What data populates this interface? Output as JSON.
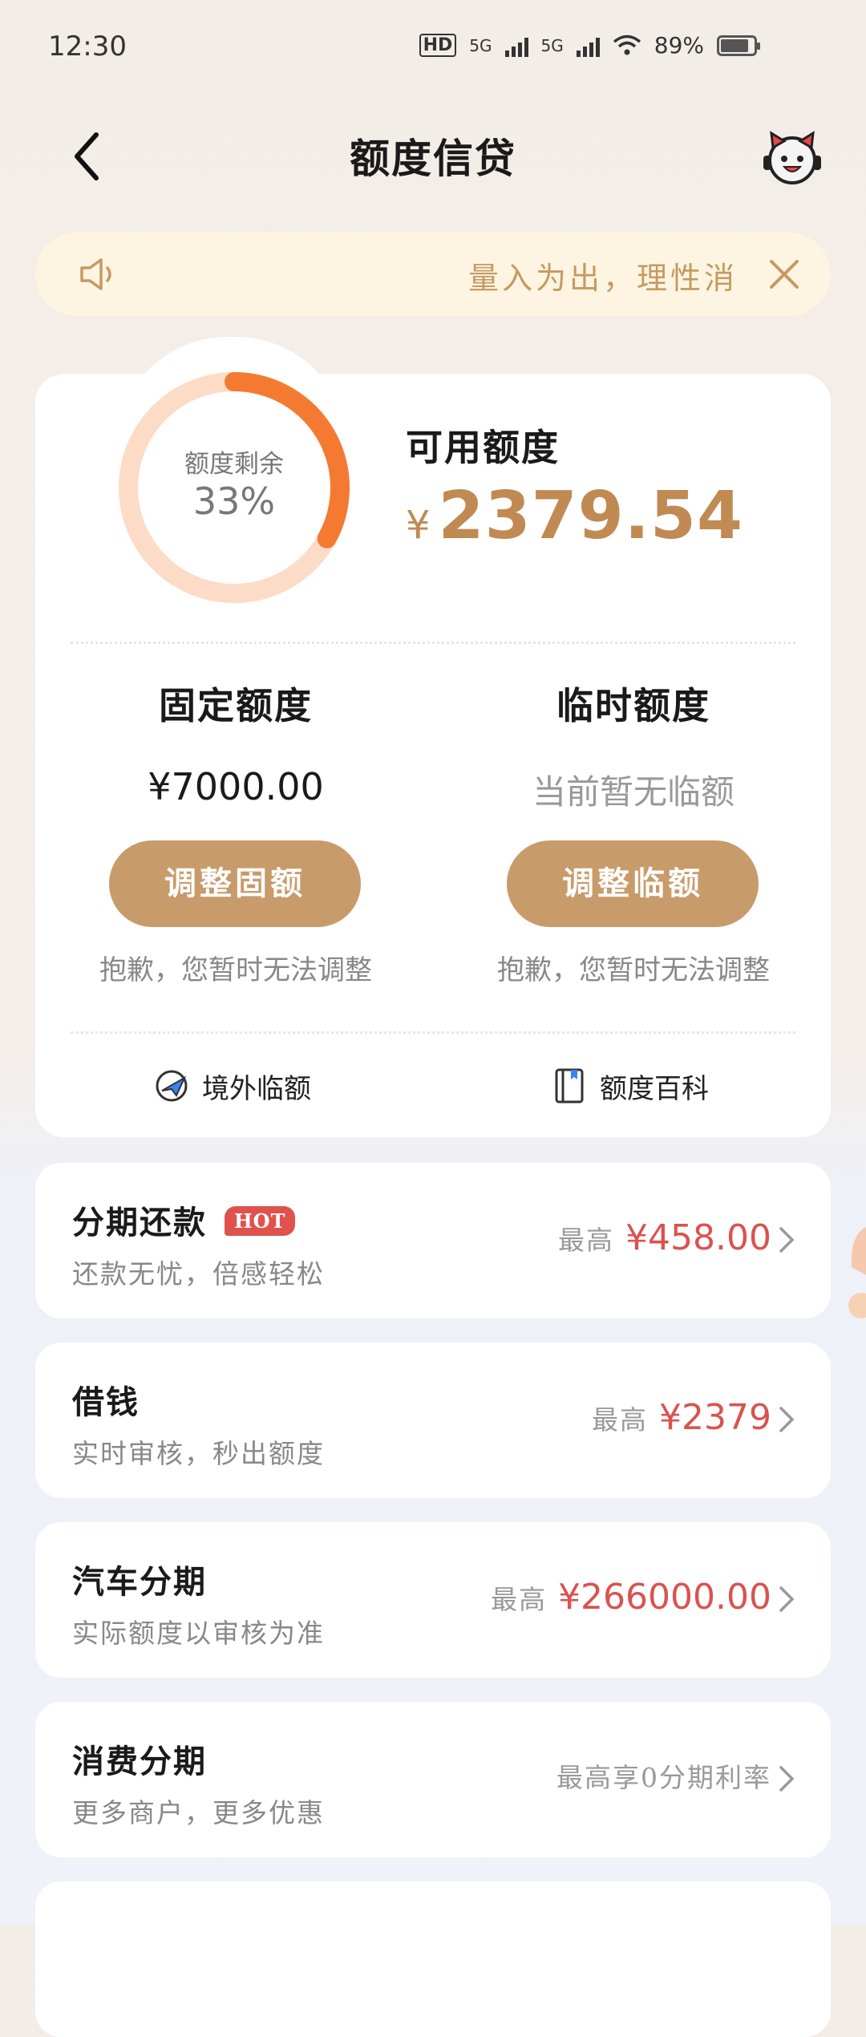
{
  "status": {
    "time": "12:30",
    "net1": "5G",
    "net2": "5G",
    "battery": "89%",
    "hd": "HD"
  },
  "header": {
    "title": "额度信贷"
  },
  "notice": {
    "text": "量入为出，理性消"
  },
  "summary": {
    "ring_label": "额度剩余",
    "ring_percent": "33%",
    "ring_fraction": 0.33,
    "available_label": "可用额度",
    "currency": "¥",
    "available_amount": "2379.54"
  },
  "fixed": {
    "title": "固定额度",
    "value": "¥7000.00",
    "button": "调整固额",
    "note": "抱歉，您暂时无法调整"
  },
  "temp": {
    "title": "临时额度",
    "value": "当前暂无临额",
    "button": "调整临额",
    "note": "抱歉，您暂时无法调整"
  },
  "links": {
    "overseas": "境外临额",
    "wiki": "额度百科"
  },
  "list": [
    {
      "title": "分期还款",
      "badge": "HOT",
      "desc": "还款无忧，倍感轻松",
      "prefix": "最高",
      "amount": "¥458.00"
    },
    {
      "title": "借钱",
      "desc": "实时审核，秒出额度",
      "prefix": "最高",
      "amount": "¥2379"
    },
    {
      "title": "汽车分期",
      "desc": "实际额度以审核为准",
      "prefix": "最高",
      "amount": "¥266000.00"
    },
    {
      "title": "消费分期",
      "desc": "更多商户，更多优惠",
      "prefix": "最高享0分期利率",
      "amount": ""
    }
  ],
  "colors": {
    "accent": "#c89b6a",
    "amount": "#c08a52",
    "ring_fg": "#f47a32",
    "ring_bg": "#fcdcc6",
    "price": "#d9534f"
  }
}
